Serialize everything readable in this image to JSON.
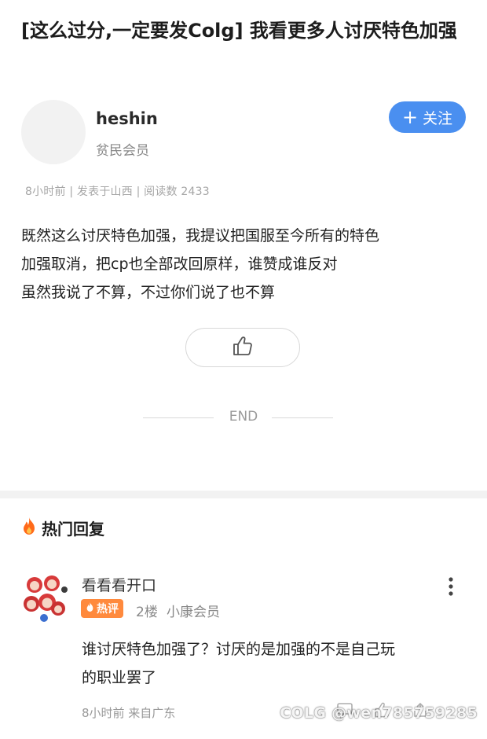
{
  "post": {
    "title": "[这么过分,一定要发Colg] 我看更多人讨厌特色加强",
    "author": {
      "name": "heshin",
      "level": "贫民会员"
    },
    "follow_label": "关注",
    "meta": "8小时前 | 发表于山西 | 阅读数 2433",
    "body_lines": [
      "既然这么讨厌特色加强，我提议把国服至今所有的特色",
      "加强取消，把cp也全部改回原样，谁赞成谁反对",
      "虽然我说了不算，不过你们说了也不算"
    ],
    "end_label": "END"
  },
  "hot_replies": {
    "title": "热门回复",
    "items": [
      {
        "name": "看看看开口",
        "badge": "热评",
        "floor": "2楼",
        "level": "小康会员",
        "text_lines": [
          "谁讨厌特色加强了？讨厌的是加强的不是自己玩",
          "的职业罢了"
        ],
        "meta": "8小时前 来自广东"
      }
    ]
  },
  "watermark": "COLG @wen785759285",
  "colors": {
    "accent": "#4a8ff0",
    "hot": "#ff8a3d",
    "fire": "#ff6a1a"
  },
  "icons": [
    "plus-icon",
    "thumbs-up-icon",
    "fire-icon",
    "more-vertical-icon",
    "reply-icon",
    "like-icon",
    "share-icon"
  ]
}
